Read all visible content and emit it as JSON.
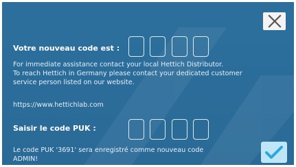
{
  "dialog": {
    "new_code_label": "Votre nouveau code est :",
    "info_lines": [
      "For immediate assistance contact your local Hettich Distributor.",
      "To reach Hettich in Germany please contact your dedicated customer",
      "service person listed on our website."
    ],
    "website": "https://www.hettichlab.com",
    "puk_label": "Saisir le code PUK :",
    "footer_lines": [
      "Le code PUK '3691' sera enregistré comme nouveau code",
      "ADMIN!"
    ]
  },
  "icons": {
    "close": "close-icon",
    "confirm": "checkmark-icon"
  },
  "colors": {
    "background": "#2b6d9a",
    "confirm_button": "#bfe6f7",
    "checkmark": "#2aa7dd"
  }
}
